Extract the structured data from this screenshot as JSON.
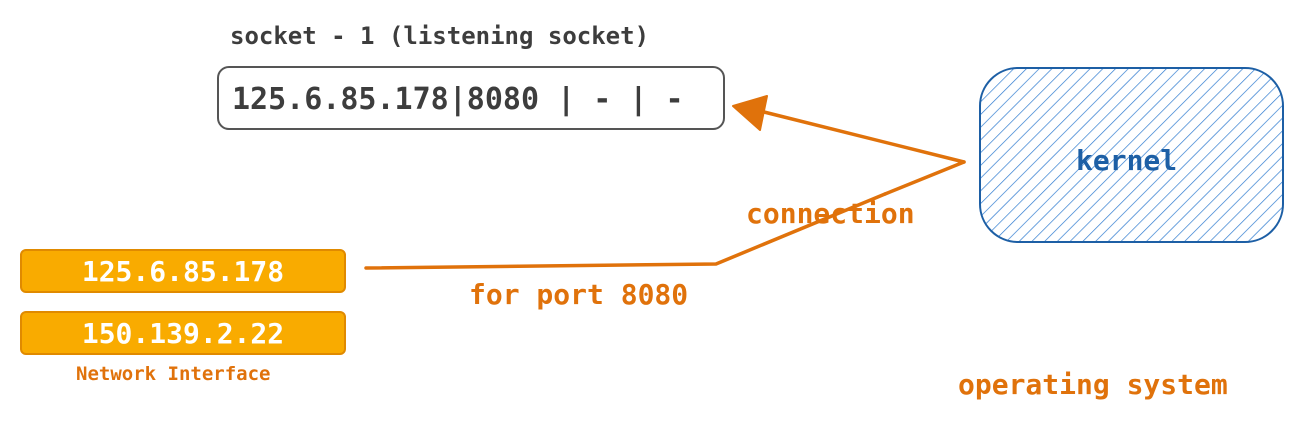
{
  "socket": {
    "title": "socket - 1 (listening socket)",
    "entry": "125.6.85.178|8080 | - | -"
  },
  "network_interface": {
    "addresses": [
      "125.6.85.178",
      "150.139.2.22"
    ],
    "caption": "Network Interface"
  },
  "kernel": {
    "label": "kernel"
  },
  "connection": {
    "label": "connection",
    "port_label": "for port 8080"
  },
  "operating_system": {
    "label": "operating system"
  },
  "colors": {
    "accent_orange": "#e0720b",
    "interface_fill": "#f9ab00",
    "kernel_blue": "#1d5fa5",
    "text_dark": "#3d3d3d"
  }
}
